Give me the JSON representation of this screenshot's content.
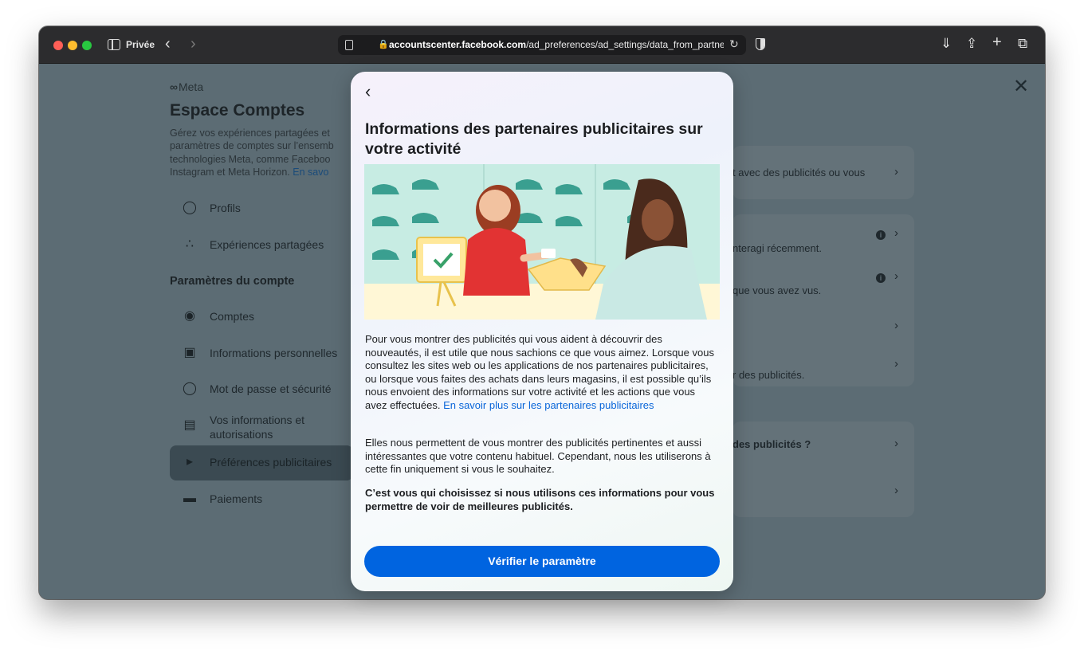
{
  "browser": {
    "private_label": "Privée",
    "url_domain": "accountscenter.facebook.com",
    "url_path": "/ad_preferences/ad_settings/data_from_partner"
  },
  "background": {
    "logo_text": "Meta",
    "title": "Espace Comptes",
    "description_lines": [
      "Gérez vos expériences partagées et",
      "paramètres de comptes sur l’ensemb",
      "technologies Meta, comme Faceboo",
      "Instagram et Meta Horizon."
    ],
    "description_link": "En savo",
    "nav": [
      {
        "label": "Profils",
        "icon": "person-icon"
      },
      {
        "label": "Expériences partagées",
        "icon": "shared-experiences-icon"
      }
    ],
    "section_heading": "Paramètres du compte",
    "account_nav": [
      {
        "label": "Comptes",
        "icon": "account-circle-icon"
      },
      {
        "label": "Informations personnelles",
        "icon": "id-card-icon"
      },
      {
        "label": "Mot de passe et sécurité",
        "icon": "shield-icon"
      },
      {
        "label": "Vos informations et autorisations",
        "icon": "info-lock-icon"
      },
      {
        "label": "Préférences publicitaires",
        "icon": "megaphone-icon",
        "active": true
      },
      {
        "label": "Paiements",
        "icon": "card-icon"
      }
    ],
    "right_rows": [
      "t avec des publicités ou vous",
      "nteragi récemment.",
      "que vous avez vus.",
      "",
      "r des publicités.",
      "des publicités ?",
      ""
    ]
  },
  "modal": {
    "back_label": "<",
    "title": "Informations des partenaires publicitaires sur votre activité",
    "paragraph1": "Pour vous montrer des publicités qui vous aident à découvrir des nouveautés, il est utile que nous sachions ce que vous aimez. Lorsque vous consultez les sites web ou les applications de nos partenaires publicitaires, ou lorsque vous faites des achats dans leurs magasins, il est possible qu’ils nous envoient des informations sur votre activité et les actions que vous avez effectuées.",
    "paragraph1_link": "En savoir plus sur les partenaires publicitaires",
    "paragraph2": "Elles nous permettent de vous montrer des publicités pertinentes et aussi intéressantes que votre contenu habituel. Cependant, nous les utiliserons à cette fin uniquement si vous le souhaitez.",
    "paragraph3": "C’est vous qui choisissez si nous utilisons ces informations pour vous permettre de voir de meilleures publicités.",
    "button_label": "Vérifier le paramètre"
  }
}
